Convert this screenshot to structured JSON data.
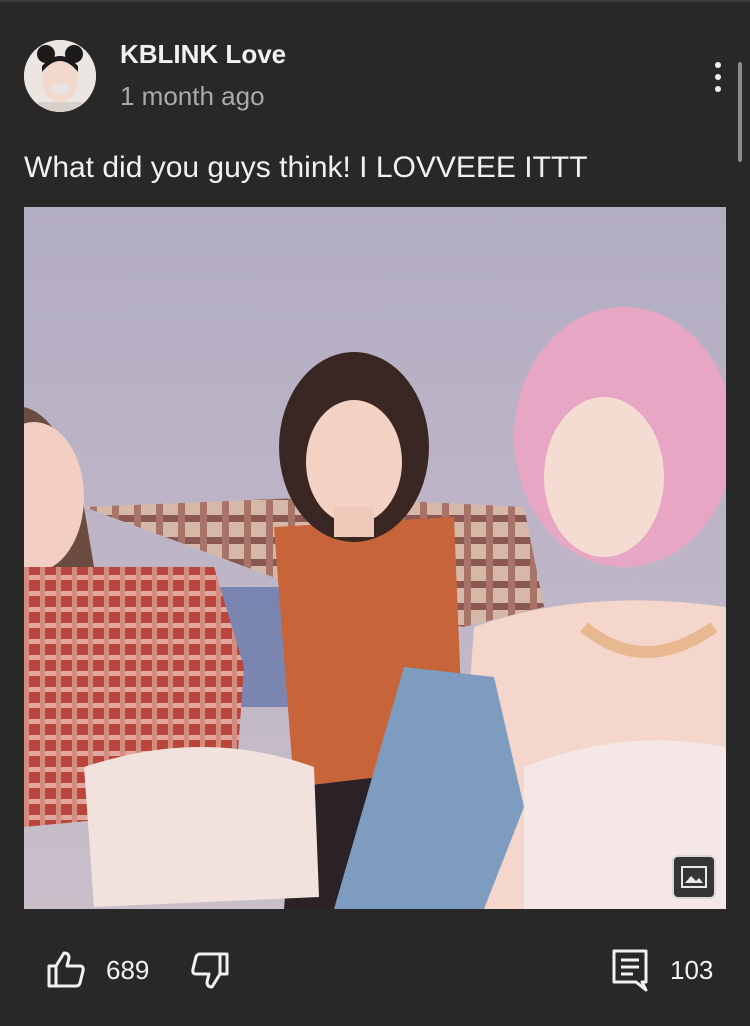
{
  "post": {
    "author": "KBLINK Love",
    "timestamp": "1 month ago",
    "text": "What did you guys think! I LOVVEEE ITTT"
  },
  "image": {
    "badge_icon": "image-icon"
  },
  "actions": {
    "like_icon": "thumbs-up-icon",
    "like_count": "689",
    "dislike_icon": "thumbs-down-icon",
    "comment_icon": "comment-icon",
    "comment_count": "103"
  },
  "menu_icon": "more-vert-icon",
  "colors": {
    "background": "#282828",
    "text_primary": "#f1f1f1",
    "text_secondary": "#aaaaaa"
  }
}
